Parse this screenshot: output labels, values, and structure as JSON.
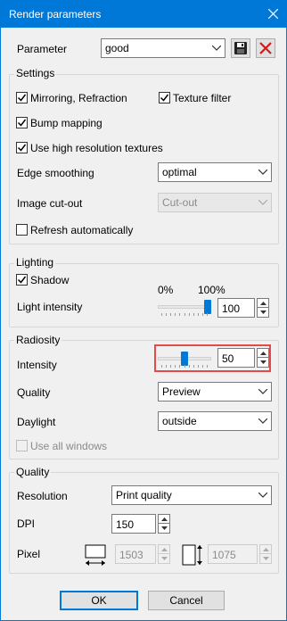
{
  "window": {
    "title": "Render parameters"
  },
  "parameter": {
    "label": "Parameter",
    "value": "good"
  },
  "settings": {
    "title": "Settings",
    "mirroring": {
      "label": "Mirroring, Refraction",
      "checked": true
    },
    "texture_filter": {
      "label": "Texture filter",
      "checked": true
    },
    "bump_mapping": {
      "label": "Bump mapping",
      "checked": true
    },
    "high_res": {
      "label": "Use high resolution textures",
      "checked": true
    },
    "edge_smoothing": {
      "label": "Edge smoothing",
      "value": "optimal"
    },
    "image_cutout": {
      "label": "Image cut-out",
      "value": "Cut-out"
    },
    "refresh": {
      "label": "Refresh automatically",
      "checked": false
    }
  },
  "lighting": {
    "title": "Lighting",
    "shadow": {
      "label": "Shadow",
      "checked": true
    },
    "slider_min": "0%",
    "slider_max": "100%",
    "light_intensity": {
      "label": "Light intensity",
      "value": "100",
      "level": 1.0
    }
  },
  "radiosity": {
    "title": "Radiosity",
    "intensity": {
      "label": "Intensity",
      "value": "50",
      "level": 0.5
    },
    "quality": {
      "label": "Quality",
      "value": "Preview"
    },
    "daylight": {
      "label": "Daylight",
      "value": "outside"
    },
    "use_all_windows": {
      "label": "Use all windows",
      "checked": false
    }
  },
  "quality": {
    "title": "Quality",
    "resolution": {
      "label": "Resolution",
      "value": "Print quality"
    },
    "dpi": {
      "label": "DPI",
      "value": "150"
    },
    "pixel": {
      "label": "Pixel",
      "width": "1503",
      "height": "1075"
    }
  },
  "buttons": {
    "ok": "OK",
    "cancel": "Cancel"
  },
  "colors": {
    "accent": "#0078d7",
    "highlight": "#e54a4a",
    "delete": "#d11a1a"
  }
}
